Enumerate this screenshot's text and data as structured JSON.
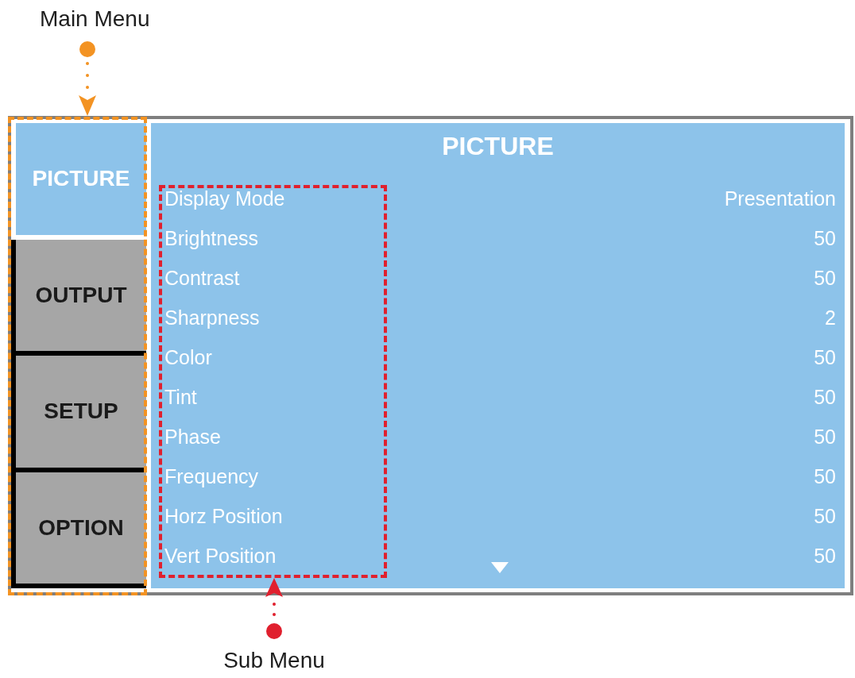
{
  "annotations": [
    {
      "kind": "menu",
      "label": "Main Menu",
      "color": "#f39323"
    },
    {
      "kind": "submenu",
      "label": "Sub Menu",
      "color": "#e0202e"
    }
  ],
  "menu": {
    "tabs": [
      {
        "label": "PICTURE",
        "selected": true
      },
      {
        "label": "OUTPUT",
        "selected": false
      },
      {
        "label": "SETUP",
        "selected": false
      },
      {
        "label": "OPTION",
        "selected": false
      }
    ],
    "panel": {
      "title": "PICTURE",
      "settings": [
        {
          "name": "Display Mode",
          "value": "Presentation"
        },
        {
          "name": "Brightness",
          "value": "50"
        },
        {
          "name": "Contrast",
          "value": "50"
        },
        {
          "name": "Sharpness",
          "value": "2"
        },
        {
          "name": "Color",
          "value": "50"
        },
        {
          "name": "Tint",
          "value": "50"
        },
        {
          "name": "Phase",
          "value": "50"
        },
        {
          "name": "Frequency",
          "value": "50"
        },
        {
          "name": "Horz Position",
          "value": "50"
        },
        {
          "name": "Vert Position",
          "value": "50"
        }
      ],
      "more_below": true
    }
  }
}
